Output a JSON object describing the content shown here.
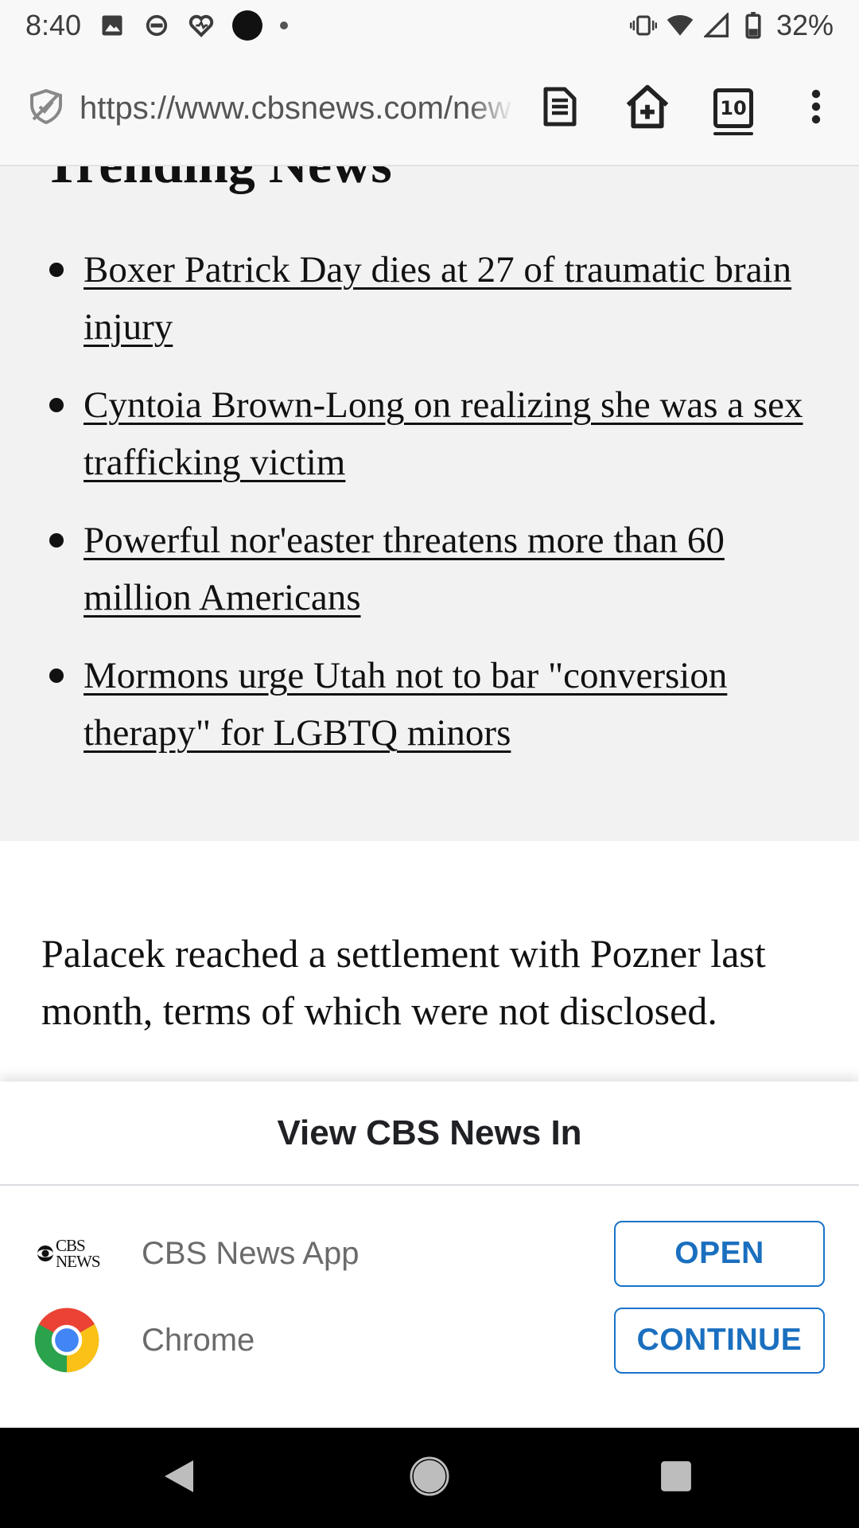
{
  "status_bar": {
    "time": "8:40",
    "battery": "32%",
    "icons": [
      "image-icon",
      "sync-icon",
      "heart-icon",
      "black-dot-icon",
      "small-dot-icon",
      "vibrate-icon",
      "wifi-icon",
      "signal-icon",
      "battery-icon"
    ]
  },
  "browser": {
    "url": "https://www.cbsnews.com/news/",
    "tab_count": "10",
    "icons": [
      "tracking-protection-icon",
      "reader-mode-icon",
      "add-to-home-icon",
      "tabs-icon",
      "overflow-menu-icon"
    ]
  },
  "trending": {
    "title": "Trending News",
    "items": [
      {
        "text": "Boxer Patrick Day dies at 27 of traumatic brain injury"
      },
      {
        "text": "Cyntoia Brown-Long on realizing she was a sex trafficking victim"
      },
      {
        "text": "Powerful nor'easter threatens more than 60 million Americans"
      },
      {
        "text": "Mormons urge Utah not to bar \"conversion therapy\" for LGBTQ minors"
      }
    ]
  },
  "article": {
    "paragraph": "Palacek reached a settlement with Pozner last month, terms of which were not disclosed."
  },
  "sheet": {
    "title": "View CBS News In",
    "apps": [
      {
        "name": "CBS News App",
        "button": "OPEN",
        "logo_text": "CBS NEWS",
        "icon": "cbs-news-logo-icon"
      },
      {
        "name": "Chrome",
        "button": "CONTINUE",
        "icon": "chrome-logo-icon"
      }
    ],
    "accent_color": "#1a73c8"
  },
  "nav_bar": {
    "icons": [
      "back-icon",
      "home-icon",
      "recents-icon"
    ]
  }
}
